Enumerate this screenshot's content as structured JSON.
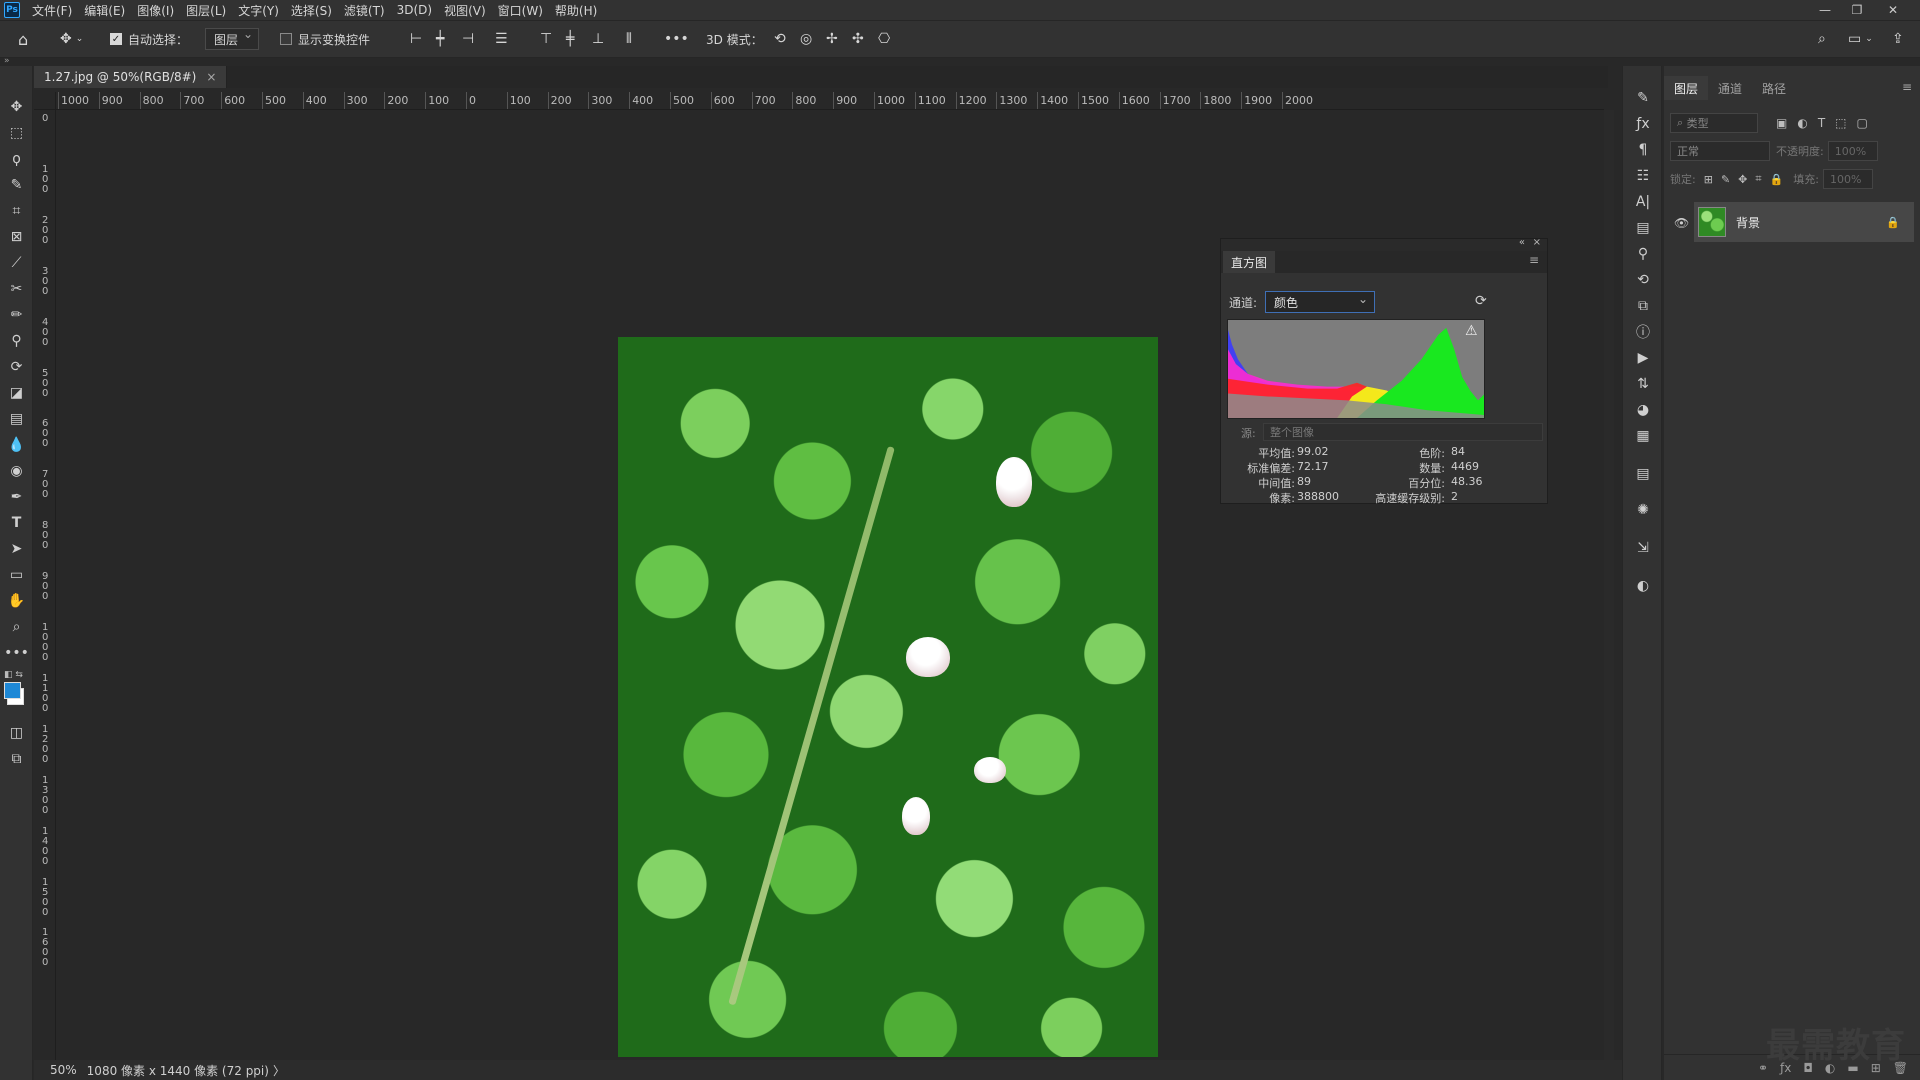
{
  "app": {
    "logo": "Ps"
  },
  "menu": [
    "文件(F)",
    "编辑(E)",
    "图像(I)",
    "图层(L)",
    "文字(Y)",
    "选择(S)",
    "滤镜(T)",
    "3D(D)",
    "视图(V)",
    "窗口(W)",
    "帮助(H)"
  ],
  "window_controls": {
    "minimize": "—",
    "restore": "❐",
    "close": "✕"
  },
  "options": {
    "auto_select_label": "自动选择：",
    "auto_select_checked": true,
    "auto_select_target": "图层",
    "show_transform_label": "显示变换控件",
    "show_transform_checked": false,
    "mode_3d_label": "3D 模式：",
    "more": "•••"
  },
  "document": {
    "tab_title": "1.27.jpg @ 50%(RGB/8#)",
    "tab_close": "×"
  },
  "ruler_h": [
    "1000",
    "900",
    "800",
    "700",
    "600",
    "500",
    "400",
    "300",
    "200",
    "100",
    "0",
    "100",
    "200",
    "300",
    "400",
    "500",
    "600",
    "700",
    "800",
    "900",
    "1000",
    "1100",
    "1200",
    "1300",
    "1400",
    "1500",
    "1600",
    "1700",
    "1800",
    "1900",
    "2000"
  ],
  "ruler_v": [
    "0",
    "1 0 0",
    "2 0 0",
    "3 0 0",
    "4 0 0",
    "5 0 0",
    "6 0 0",
    "7 0 0",
    "8 0 0",
    "9 0 0",
    "1 0 0 0",
    "1 1 0 0",
    "1 2 0 0",
    "1 3 0 0",
    "1 4 0 0",
    "1 5 0 0",
    "1 6 0 0"
  ],
  "tools": [
    "move-tool",
    "marquee-tool",
    "lasso-tool",
    "quick-select-tool",
    "crop-tool",
    "frame-tool",
    "eyedropper-tool",
    "healing-tool",
    "brush-tool",
    "stamp-tool",
    "history-brush-tool",
    "eraser-tool",
    "gradient-tool",
    "blur-tool",
    "dodge-tool",
    "pen-tool",
    "type-tool",
    "path-select-tool",
    "rectangle-tool",
    "hand-tool",
    "zoom-tool",
    "more-tools"
  ],
  "colors": {
    "foreground": "#1e88d6",
    "background": "#ffffff",
    "accent": "#3f6fb5"
  },
  "layers_panel": {
    "tabs": [
      "图层",
      "通道",
      "路径"
    ],
    "active_tab": "图层",
    "filter_placeholder": "类型",
    "blend_mode": "正常",
    "opacity_label": "不透明度:",
    "opacity_value": "100%",
    "lock_label": "锁定:",
    "fill_label": "填充:",
    "fill_value": "100%",
    "layers": [
      {
        "name": "背景",
        "visible": true,
        "locked": true
      }
    ]
  },
  "histogram": {
    "title": "直方图",
    "channel_label": "通道:",
    "channel_value": "颜色",
    "source_label": "源:",
    "source_value": "整个图像",
    "stats_left": [
      {
        "label": "平均值:",
        "value": "99.02"
      },
      {
        "label": "标准偏差:",
        "value": "72.17"
      },
      {
        "label": "中间值:",
        "value": "89"
      },
      {
        "label": "像素:",
        "value": "388800"
      }
    ],
    "stats_right": [
      {
        "label": "色阶:",
        "value": "84"
      },
      {
        "label": "数量:",
        "value": "4469"
      },
      {
        "label": "百分位:",
        "value": "48.36"
      },
      {
        "label": "高速缓存级别:",
        "value": "2"
      }
    ],
    "warning_icon": "⚠"
  },
  "status": {
    "zoom": "50%",
    "info": "1080 像素 x 1440 像素 (72 ppi)",
    "arrow": "〉"
  },
  "watermark": "最需教育"
}
